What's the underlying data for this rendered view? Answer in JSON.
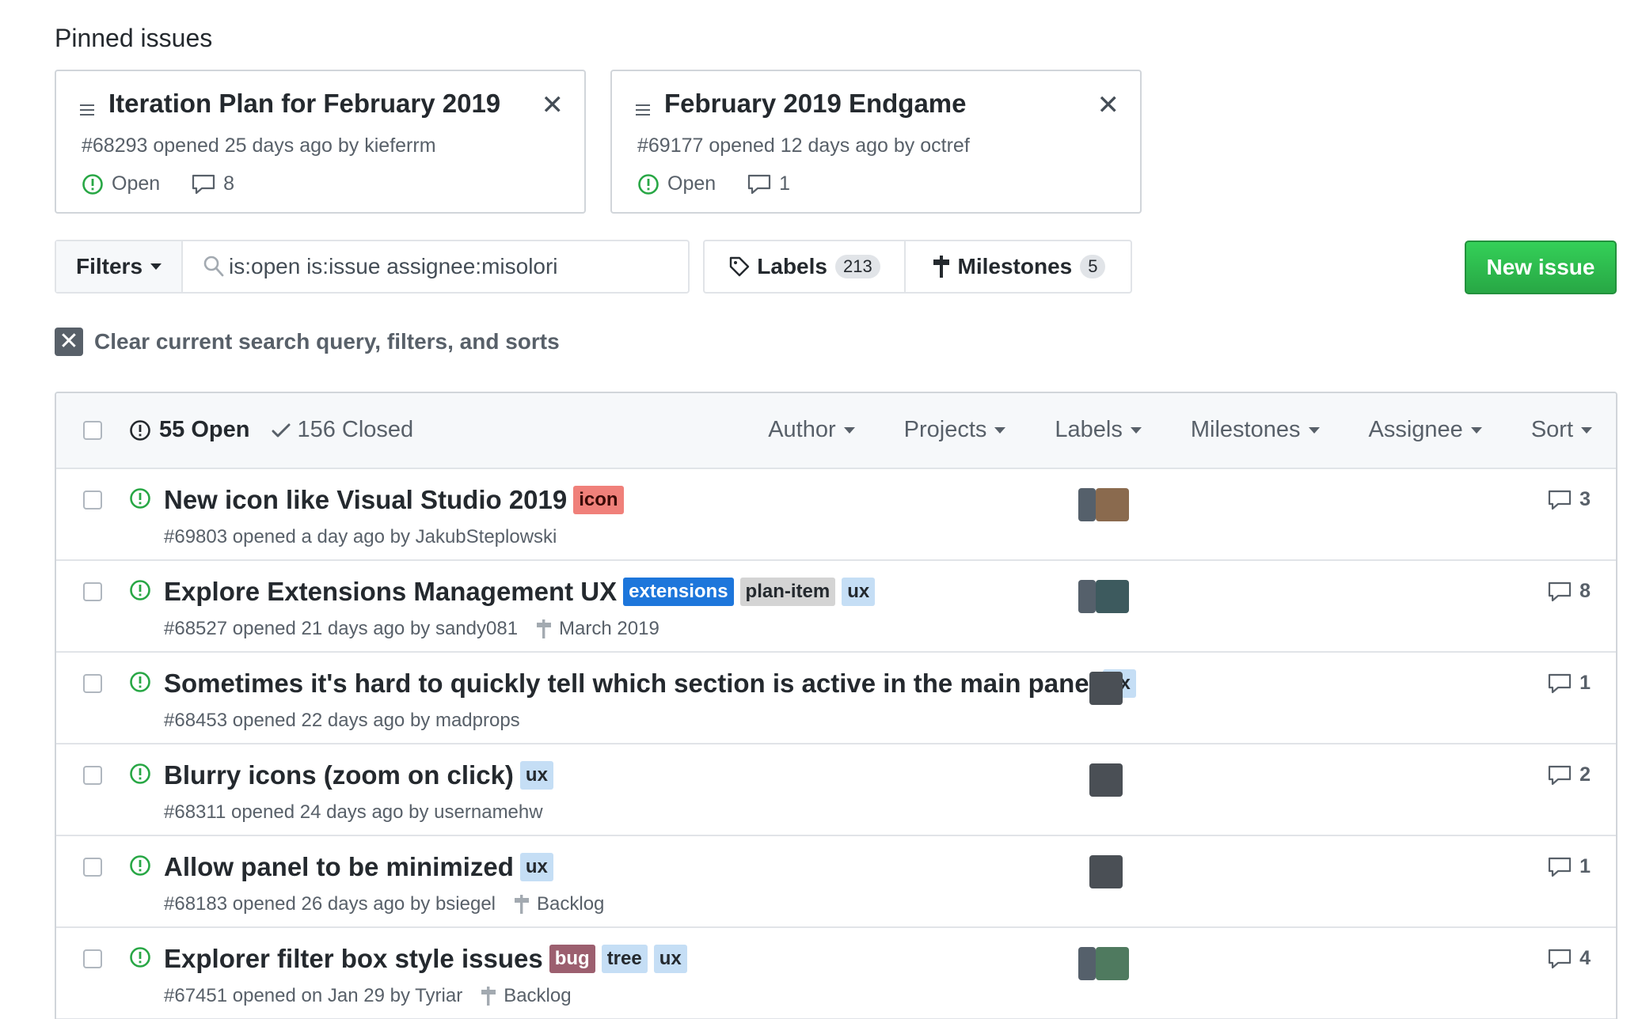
{
  "pinned": {
    "heading": "Pinned issues",
    "cards": [
      {
        "title": "Iteration Plan for February 2019",
        "meta": "#68293 opened 25 days ago by kieferrm",
        "state": "Open",
        "comments": "8"
      },
      {
        "title": "February 2019 Endgame",
        "meta": "#69177 opened 12 days ago by octref",
        "state": "Open",
        "comments": "1"
      }
    ]
  },
  "toolbar": {
    "filters_label": "Filters",
    "search_value": "is:open is:issue assignee:misolori",
    "labels_label": "Labels",
    "labels_count": "213",
    "milestones_label": "Milestones",
    "milestones_count": "5",
    "new_issue_label": "New issue"
  },
  "clear": {
    "label": "Clear current search query, filters, and sorts"
  },
  "list_header": {
    "open_label": "55 Open",
    "closed_label": "156 Closed",
    "filters": [
      "Author",
      "Projects",
      "Labels",
      "Milestones",
      "Assignee",
      "Sort"
    ]
  },
  "issues": [
    {
      "title": "New icon like Visual Studio 2019",
      "labels": [
        {
          "name": "icon",
          "bg": "#f0807a",
          "fg": "#3a0a06"
        }
      ],
      "meta": "#69803 opened a day ago by JakubSteplowski",
      "milestone": "",
      "comments": "3"
    },
    {
      "title": "Explore Extensions Management UX",
      "labels": [
        {
          "name": "extensions",
          "bg": "#1d76db",
          "fg": "#ffffff"
        },
        {
          "name": "plan-item",
          "bg": "#d4d4d4",
          "fg": "#24292e"
        },
        {
          "name": "ux",
          "bg": "#c5def5",
          "fg": "#24292e"
        }
      ],
      "meta": "#68527 opened 21 days ago by sandy081",
      "milestone": "March 2019",
      "comments": "8"
    },
    {
      "title": "Sometimes it's hard to quickly tell which section is active in the main panel",
      "labels": [
        {
          "name": "ux",
          "bg": "#c5def5",
          "fg": "#24292e"
        }
      ],
      "meta": "#68453 opened 22 days ago by madprops",
      "milestone": "",
      "comments": "1"
    },
    {
      "title": "Blurry icons (zoom on click)",
      "labels": [
        {
          "name": "ux",
          "bg": "#c5def5",
          "fg": "#24292e"
        }
      ],
      "meta": "#68311 opened 24 days ago by usernamehw",
      "milestone": "",
      "comments": "2"
    },
    {
      "title": "Allow panel to be minimized",
      "labels": [
        {
          "name": "ux",
          "bg": "#c5def5",
          "fg": "#24292e"
        }
      ],
      "meta": "#68183 opened 26 days ago by bsiegel",
      "milestone": "Backlog",
      "comments": "1"
    },
    {
      "title": "Explorer filter box style issues",
      "labels": [
        {
          "name": "bug",
          "bg": "#9c5f6f",
          "fg": "#ffffff"
        },
        {
          "name": "tree",
          "bg": "#c5def5",
          "fg": "#24292e"
        },
        {
          "name": "ux",
          "bg": "#c5def5",
          "fg": "#24292e"
        }
      ],
      "meta": "#67451 opened on Jan 29 by Tyriar",
      "milestone": "Backlog",
      "comments": "4"
    }
  ],
  "colors": {
    "open_green": "#28a745",
    "button_green": "#2ea44f"
  }
}
